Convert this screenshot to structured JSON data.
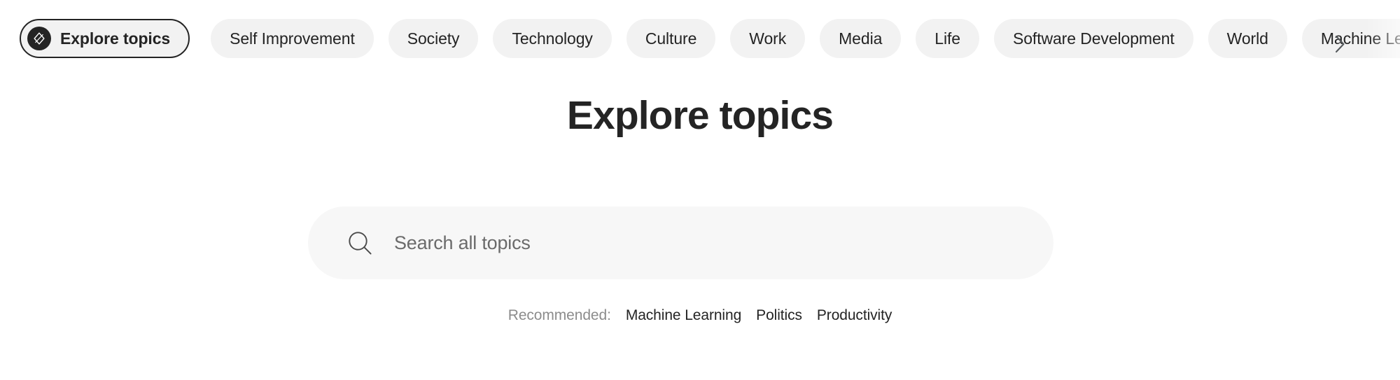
{
  "topic_strip": {
    "explore_button": {
      "label": "Explore topics",
      "icon": "compass-icon"
    },
    "topics": [
      {
        "label": "Self Improvement"
      },
      {
        "label": "Society"
      },
      {
        "label": "Technology"
      },
      {
        "label": "Culture"
      },
      {
        "label": "Work"
      },
      {
        "label": "Media"
      },
      {
        "label": "Life"
      },
      {
        "label": "Software Development"
      },
      {
        "label": "World"
      },
      {
        "label": "Machine Learning"
      }
    ],
    "scroll_right": {
      "icon": "chevron-right-icon"
    }
  },
  "hero": {
    "title": "Explore topics",
    "search": {
      "icon": "search-icon",
      "placeholder": "Search all topics",
      "value": ""
    },
    "recommended": {
      "label": "Recommended:",
      "links": [
        {
          "label": "Machine Learning"
        },
        {
          "label": "Politics"
        },
        {
          "label": "Productivity"
        }
      ]
    }
  },
  "colors": {
    "text": "#242424",
    "muted": "#8c8c8c",
    "placeholder": "#6b6b6b",
    "pill_bg": "#f2f2f2",
    "search_bg": "#f7f7f7",
    "page_bg": "#ffffff"
  }
}
